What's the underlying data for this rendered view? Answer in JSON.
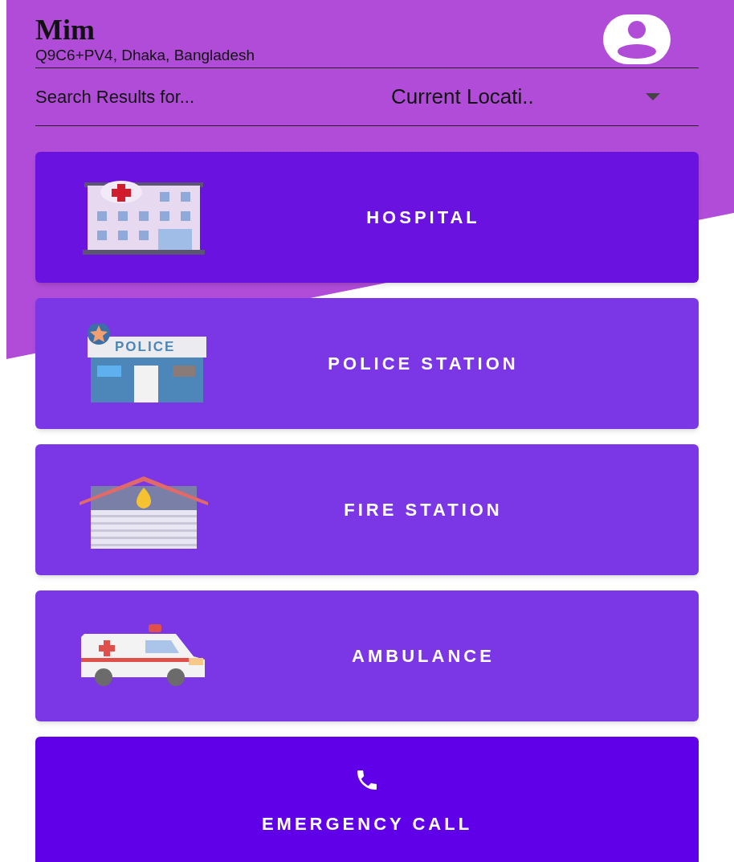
{
  "user": {
    "name": "Mim",
    "address": "Q9C6+PV4, Dhaka, Bangladesh"
  },
  "search": {
    "label": "Search Results for...",
    "value": "Current Locati.."
  },
  "services": [
    {
      "kind": "hospital",
      "label": "HOSPITAL"
    },
    {
      "kind": "police",
      "label": "POLICE STATION",
      "sign_text": "POLICE"
    },
    {
      "kind": "fire",
      "label": "FIRE STATION"
    },
    {
      "kind": "ambulance",
      "label": "AMBULANCE"
    }
  ],
  "emergency_button": {
    "label": "EMERGENCY CALL"
  }
}
